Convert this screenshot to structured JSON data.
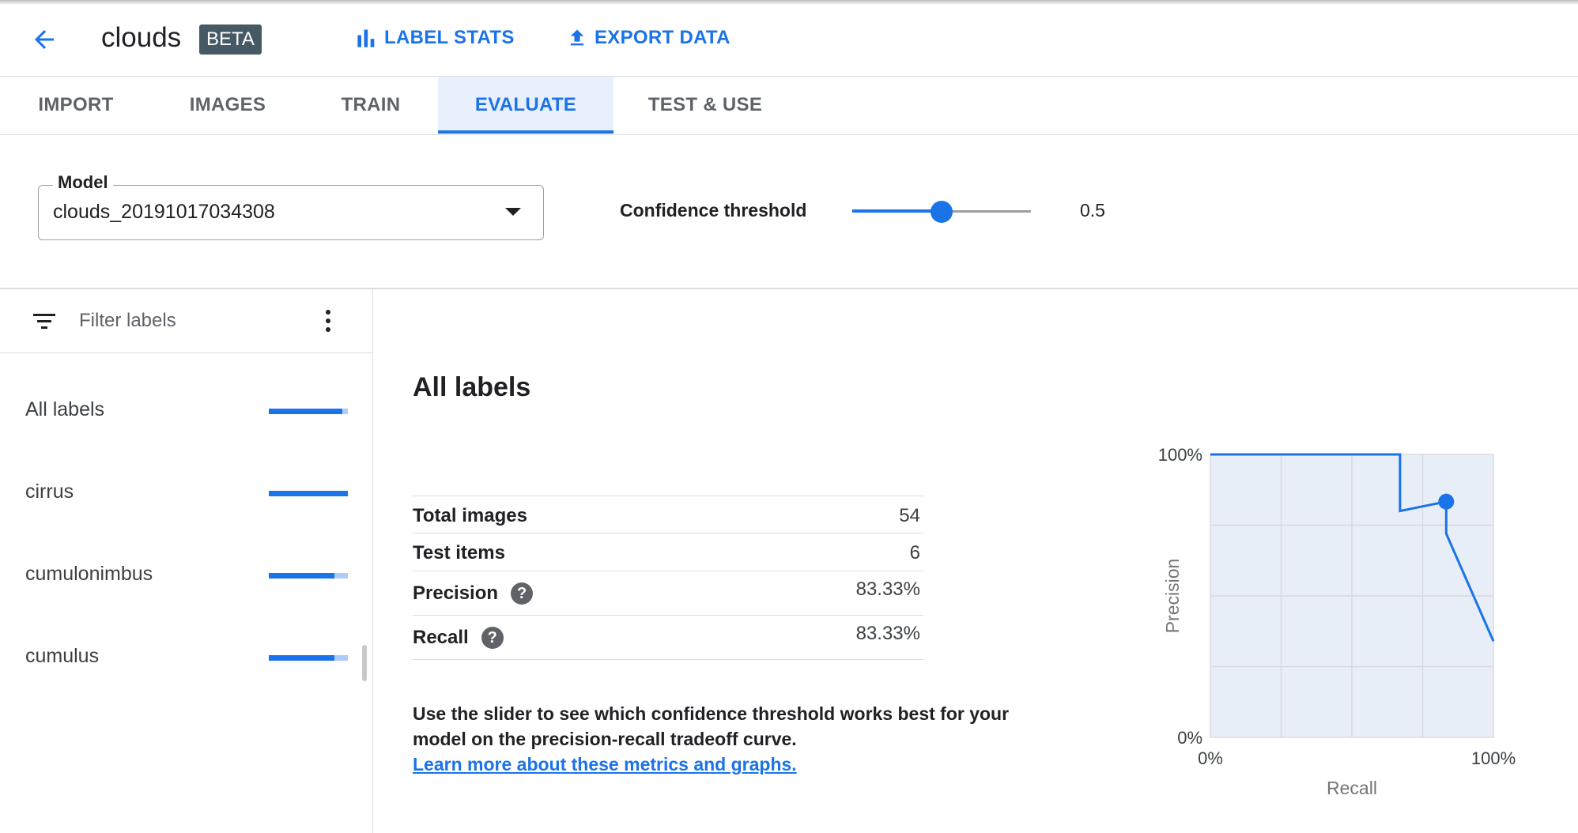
{
  "header": {
    "title": "clouds",
    "badge": "BETA",
    "actions": [
      {
        "label": "LABEL STATS",
        "icon": "bar-chart-icon"
      },
      {
        "label": "EXPORT DATA",
        "icon": "upload-icon"
      }
    ]
  },
  "tabs": [
    {
      "label": "IMPORT",
      "active": false
    },
    {
      "label": "IMAGES",
      "active": false
    },
    {
      "label": "TRAIN",
      "active": false
    },
    {
      "label": "EVALUATE",
      "active": true
    },
    {
      "label": "TEST & USE",
      "active": false
    }
  ],
  "model": {
    "label": "Model",
    "value": "clouds_20191017034308"
  },
  "confidence": {
    "label": "Confidence threshold",
    "value": "0.5",
    "slider_fraction": 0.5
  },
  "sidebar": {
    "filter_placeholder": "Filter labels",
    "labels": [
      {
        "name": "All labels",
        "score": 0.93
      },
      {
        "name": "cirrus",
        "score": 1.0
      },
      {
        "name": "cumulonimbus",
        "score": 0.83
      },
      {
        "name": "cumulus",
        "score": 0.83
      }
    ]
  },
  "main": {
    "title": "All labels",
    "metrics": [
      {
        "name": "Total images",
        "value": "54",
        "help": false
      },
      {
        "name": "Test items",
        "value": "6",
        "help": false
      },
      {
        "name": "Precision",
        "value": "83.33%",
        "help": true
      },
      {
        "name": "Recall",
        "value": "83.33%",
        "help": true
      }
    ],
    "help_text": "Use the slider to see which confidence threshold works best for your model on the precision-recall tradeoff curve.",
    "help_link": "Learn more about these metrics and graphs.",
    "help_icon_glyph": "?"
  },
  "chart_data": {
    "type": "line",
    "xlabel": "Recall",
    "ylabel": "Precision",
    "xlim": [
      0,
      100
    ],
    "ylim": [
      0,
      100
    ],
    "x_tick_labels": [
      "0%",
      "100%"
    ],
    "y_tick_labels": [
      "0%",
      "100%"
    ],
    "grid": true,
    "series": [
      {
        "x": [
          0,
          67,
          67,
          83.33,
          83.33,
          100
        ],
        "y": [
          100,
          100,
          80,
          83.33,
          72,
          34
        ],
        "color": "#1a73e8"
      }
    ],
    "highlight_point": {
      "x": 83.33,
      "y": 83.33
    }
  },
  "colors": {
    "accent": "#1a73e8",
    "badge_bg": "#455a64",
    "chart_fill": "#e8eef8"
  }
}
